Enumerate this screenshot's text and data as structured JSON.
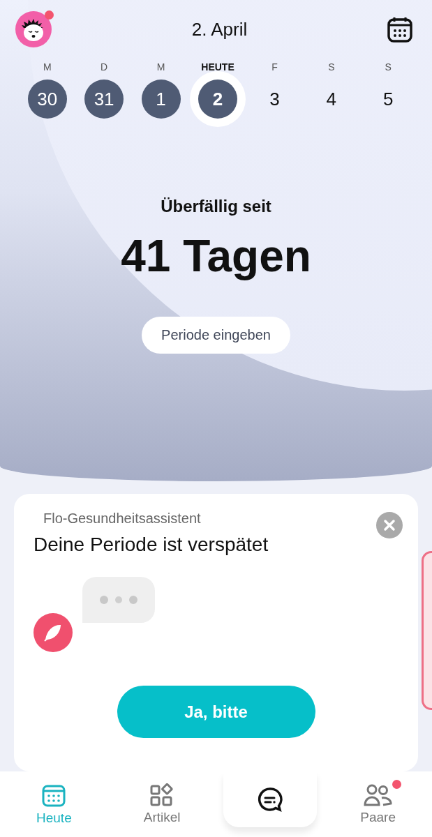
{
  "header": {
    "title": "2. April",
    "avatar_badge": true
  },
  "days": [
    {
      "label": "M",
      "number": "30",
      "filled": true,
      "selected": false
    },
    {
      "label": "D",
      "number": "31",
      "filled": true,
      "selected": false
    },
    {
      "label": "M",
      "number": "1",
      "filled": true,
      "selected": false
    },
    {
      "label": "HEUTE",
      "number": "2",
      "filled": true,
      "selected": true
    },
    {
      "label": "F",
      "number": "3",
      "filled": false,
      "selected": false
    },
    {
      "label": "S",
      "number": "4",
      "filled": false,
      "selected": false
    },
    {
      "label": "S",
      "number": "5",
      "filled": false,
      "selected": false
    }
  ],
  "status": {
    "caption": "Überfällig seit",
    "headline": "41 Tagen",
    "button": "Periode eingeben"
  },
  "card": {
    "source": "Flo-Gesundheitsassistent",
    "title": "Deine Periode ist verspätet",
    "action": "Ja, bitte"
  },
  "nav": [
    {
      "kind": "calendar",
      "label": "Heute",
      "selected": true,
      "badge": false
    },
    {
      "kind": "grid",
      "label": "Artikel",
      "selected": false,
      "badge": false
    },
    {
      "kind": "chat",
      "selected": false,
      "badge": false
    },
    {
      "kind": "people",
      "label": "Paare",
      "selected": false,
      "badge": true
    }
  ]
}
